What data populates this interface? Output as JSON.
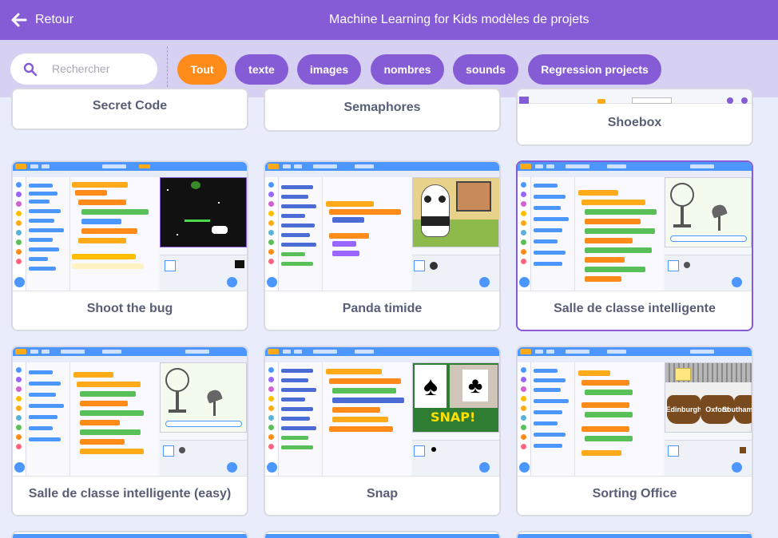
{
  "header": {
    "back_label": "Retour",
    "title": "Machine Learning for Kids modèles de projets"
  },
  "search": {
    "placeholder": "Rechercher"
  },
  "filters": [
    "Tout",
    "texte",
    "images",
    "nombres",
    "sounds",
    "Regression projects"
  ],
  "active_filter": "Tout",
  "colors": {
    "accent": "#855cd6",
    "active_filter": "#ff8c1a",
    "header": "#855cd6",
    "filter_bar": "#d6d0f3"
  },
  "cards": [
    {
      "label": "Secret Code"
    },
    {
      "label": "Semaphores"
    },
    {
      "label": "Shoebox"
    },
    {
      "label": "Shoot the bug"
    },
    {
      "label": "Panda timide"
    },
    {
      "label": "Salle de classe intelligente"
    },
    {
      "label": "Salle de classe intelligente (easy)"
    },
    {
      "label": "Snap"
    },
    {
      "label": "Sorting Office"
    },
    {
      "label": ""
    },
    {
      "label": ""
    },
    {
      "label": ""
    }
  ],
  "thumb_text": {
    "snap": "SNAP!",
    "cities": [
      "Edinburgh",
      "Oxford",
      "Southampton"
    ]
  }
}
